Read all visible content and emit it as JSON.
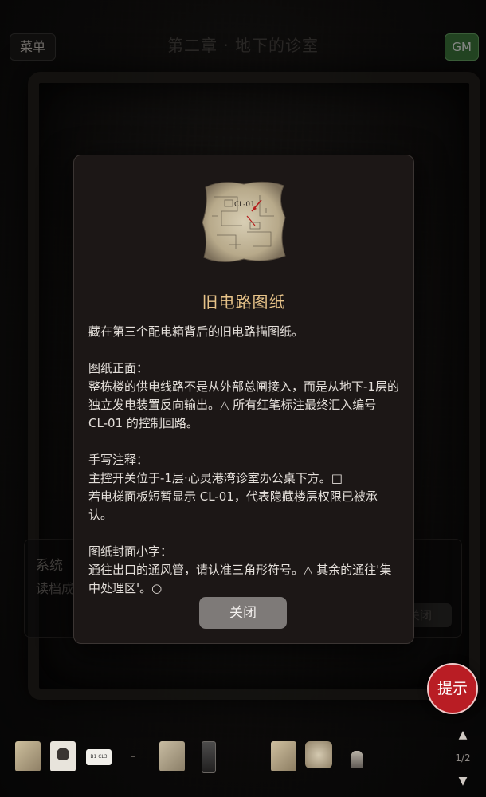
{
  "header": {
    "menu_label": "菜单",
    "chapter_title": "第二章 · 地下的诊室",
    "gm_label": "GM"
  },
  "system_panel": {
    "title": "系统",
    "text": "读档成",
    "close_label": "关闭"
  },
  "dialog": {
    "item_icon": "old-circuit-diagram-paper",
    "item_name": "旧电路图纸",
    "intro": "藏在第三个配电箱背后的旧电路描图纸。",
    "front_heading": "图纸正面：",
    "front_text": "整栋楼的供电线路不是从外部总闸接入，而是从地下-1层的独立发电装置反向输出。△ 所有红笔标注最终汇入编号 CL-01 的控制回路。",
    "note_heading": "手写注释：",
    "note_line1": "主控开关位于-1层·心灵港湾诊室办公桌下方。□",
    "note_line2": "若电梯面板短暂显示 CL-01，代表隐藏楼层权限已被承认。",
    "cover_heading": "图纸封面小字：",
    "cover_text": "通往出口的通风管，请认准三角形符号。△ 其余的通往'集中处理区'。○",
    "close_label": "关闭"
  },
  "hint_label": "提示",
  "inventory": {
    "items": [
      "parchment-icon",
      "skull-poster-icon",
      "label-card-icon",
      "empty-slot",
      "anatomy-chart-icon",
      "glass-icon",
      "parchment-icon",
      "circuit-diagram-icon",
      "figurine-icon"
    ],
    "label_card_text": "B1·CL3",
    "page": "1/2"
  }
}
